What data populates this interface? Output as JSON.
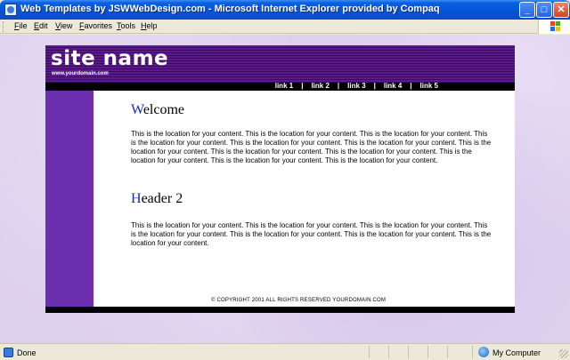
{
  "window": {
    "title": "Web Templates by JSWWebDesign.com - Microsoft Internet Explorer provided by Compaq",
    "minimize_label": "_",
    "maximize_label": "□",
    "close_label": "✕"
  },
  "menu": {
    "items": [
      "File",
      "Edit",
      "View",
      "Favorites",
      "Tools",
      "Help"
    ]
  },
  "site": {
    "name": "site name",
    "domain": "www.yourdomain.com",
    "nav": [
      "link 1",
      "link 2",
      "link 3",
      "link 4",
      "link 5"
    ],
    "nav_separator": "|",
    "sections": [
      {
        "heading_cap": "W",
        "heading_rest": "elcome",
        "body": "This is the location for your content. This is the location for your content. This is the location for your content. This is the location for your content. This is the location for your content. This is the location for your content. This is the location for your content. This is the location for your content. This is the location for your content. This is the location for your content. This is the location for your content. This is the location for your content."
      },
      {
        "heading_cap": "H",
        "heading_rest": "eader 2",
        "body": "This is the location for your content. This is the location for your content. This is the location for your content. This is the location for your content. This is the location for your content. This is the location for your content. This is the location for your content."
      }
    ],
    "copyright": "© COPYRIGHT 2001 ALL RIGHTS RESERVED YOURDOMAIN.COM"
  },
  "status": {
    "text": "Done",
    "zone": "My Computer"
  },
  "colors": {
    "header_purple": "#5a1a8a",
    "sidebar_purple": "#6b2fb0",
    "heading_initial": "#1a24c8"
  }
}
